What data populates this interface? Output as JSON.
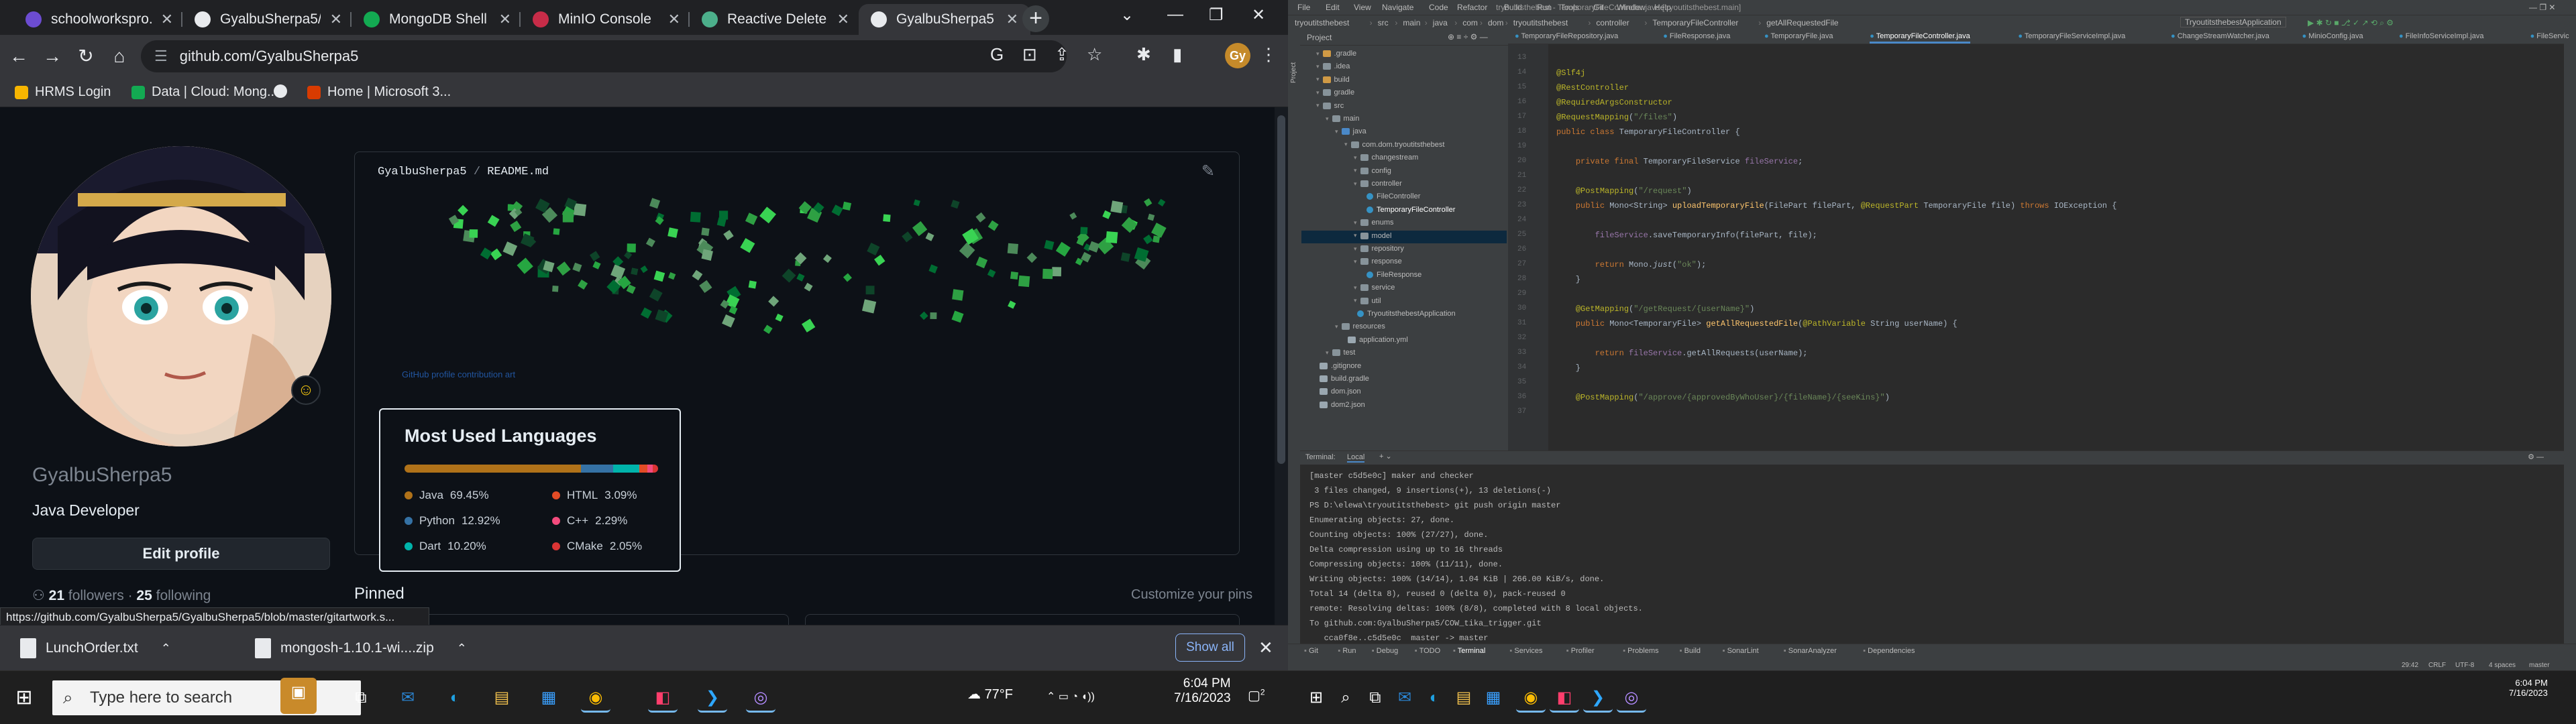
{
  "chrome": {
    "tabs": [
      {
        "title": "schoolworkspro.c",
        "color": "#6c4cd1"
      },
      {
        "title": "GyalbuSherpa5/C",
        "color": "#e8eaed"
      },
      {
        "title": "MongoDB Shell D",
        "color": "#13aa52"
      },
      {
        "title": "MinIO Console",
        "color": "#c72c48"
      },
      {
        "title": "Reactive Delete u",
        "color": "#4caf8b"
      },
      {
        "title": "GyalbuSherpa5",
        "color": "#e8eaed"
      }
    ],
    "url": "github.com/GyalbuSherpa5",
    "profile_initial": "Gy",
    "bookmarks": [
      "HRMS Login",
      "Data | Cloud: Mong...",
      "Home | Microsoft 3..."
    ],
    "status_url": "https://github.com/GyalbuSherpa5/GyalbuSherpa5/blob/master/gitartwork.s...",
    "downloads": [
      {
        "name": "LunchOrder.txt"
      },
      {
        "name": "mongosh-1.10.1-wi....zip"
      }
    ],
    "show_all": "Show all"
  },
  "github": {
    "username": "GyalbuSherpa5",
    "bio": "Java Developer",
    "edit_profile": "Edit profile",
    "followers_count": "21",
    "followers_label": "followers",
    "following_count": "25",
    "following_label": "following",
    "readme_owner": "GyalbuSherpa5",
    "readme_file": "README.md",
    "art_link": "GitHub profile contribution art",
    "pinned": "Pinned",
    "customize": "Customize your pins",
    "languages": {
      "title": "Most Used Languages",
      "items": [
        {
          "name": "Java",
          "pct": "69.45%",
          "value": 69.45,
          "color": "#b07219"
        },
        {
          "name": "Python",
          "pct": "12.92%",
          "value": 12.92,
          "color": "#3572a5"
        },
        {
          "name": "Dart",
          "pct": "10.20%",
          "value": 10.2,
          "color": "#00b4ab"
        },
        {
          "name": "HTML",
          "pct": "3.09%",
          "value": 3.09,
          "color": "#e34c26"
        },
        {
          "name": "C++",
          "pct": "2.29%",
          "value": 2.29,
          "color": "#f34b7d"
        },
        {
          "name": "CMake",
          "pct": "2.05%",
          "value": 2.05,
          "color": "#da3434"
        }
      ]
    }
  },
  "ide": {
    "menu": [
      "File",
      "Edit",
      "View",
      "Navigate",
      "Code",
      "Refactor",
      "Build",
      "Run",
      "Tools",
      "Git",
      "Window",
      "Help"
    ],
    "window_title": "tryoutitsthebest - TemporaryFileController.java [tryoutitsthebest.main]",
    "breadcrumbs": [
      "tryoutitsthebest",
      "src",
      "main",
      "java",
      "com",
      "dom",
      "tryoutitsthebest",
      "controller",
      "TemporaryFileController",
      "getAllRequestedFile"
    ],
    "run_config": "TryoutitsthebestApplication",
    "project_label": "Project",
    "tree": [
      {
        "label": ".gradle",
        "depth": 1,
        "kind": "folder-orange"
      },
      {
        "label": ".idea",
        "depth": 1,
        "kind": "folder"
      },
      {
        "label": "build",
        "depth": 1,
        "kind": "folder-orange"
      },
      {
        "label": "gradle",
        "depth": 1,
        "kind": "folder"
      },
      {
        "label": "src",
        "depth": 1,
        "kind": "folder"
      },
      {
        "label": "main",
        "depth": 2,
        "kind": "folder"
      },
      {
        "label": "java",
        "depth": 3,
        "kind": "folder-blue"
      },
      {
        "label": "com.dom.tryoutitsthebest",
        "depth": 4,
        "kind": "package"
      },
      {
        "label": "changestream",
        "depth": 5,
        "kind": "package"
      },
      {
        "label": "config",
        "depth": 5,
        "kind": "package"
      },
      {
        "label": "controller",
        "depth": 5,
        "kind": "package"
      },
      {
        "label": "FileController",
        "depth": 6,
        "kind": "class"
      },
      {
        "label": "TemporaryFileController",
        "depth": 6,
        "kind": "class"
      },
      {
        "label": "enums",
        "depth": 5,
        "kind": "package"
      },
      {
        "label": "model",
        "depth": 5,
        "kind": "package"
      },
      {
        "label": "repository",
        "depth": 5,
        "kind": "package"
      },
      {
        "label": "response",
        "depth": 5,
        "kind": "package"
      },
      {
        "label": "FileResponse",
        "depth": 6,
        "kind": "class"
      },
      {
        "label": "service",
        "depth": 5,
        "kind": "package"
      },
      {
        "label": "util",
        "depth": 5,
        "kind": "package"
      },
      {
        "label": "TryoutitsthebestApplication",
        "depth": 5,
        "kind": "class"
      },
      {
        "label": "resources",
        "depth": 3,
        "kind": "folder"
      },
      {
        "label": "application.yml",
        "depth": 4,
        "kind": "file"
      },
      {
        "label": "test",
        "depth": 2,
        "kind": "folder"
      },
      {
        "label": ".gitignore",
        "depth": 1,
        "kind": "file"
      },
      {
        "label": "build.gradle",
        "depth": 1,
        "kind": "file"
      },
      {
        "label": "dom.json",
        "depth": 1,
        "kind": "file"
      },
      {
        "label": "dom2.json",
        "depth": 1,
        "kind": "file"
      }
    ],
    "editor_tabs": [
      "TemporaryFileRepository.java",
      "FileResponse.java",
      "TemporaryFile.java",
      "TemporaryFileController.java",
      "TemporaryFileServiceImpl.java",
      "ChangeStreamWatcher.java",
      "MinioConfig.java",
      "FileInfoServiceImpl.java",
      "FileServic"
    ],
    "terminal": {
      "title": "Terminal:",
      "tab": "Local",
      "lines": [
        "[master c5d5e0c] maker and checker",
        " 3 files changed, 9 insertions(+), 13 deletions(-)",
        "PS D:\\elewa\\tryoutitsthebest> git push origin master",
        "Enumerating objects: 27, done.",
        "Counting objects: 100% (27/27), done.",
        "Delta compression using up to 16 threads",
        "Compressing objects: 100% (11/11), done.",
        "Writing objects: 100% (14/14), 1.04 KiB | 266.00 KiB/s, done.",
        "Total 14 (delta 8), reused 0 (delta 0), pack-reused 0",
        "remote: Resolving deltas: 100% (8/8), completed with 8 local objects.",
        "To github.com:GyalbuSherpa5/COW_tika_trigger.git",
        "   cca0f8e..c5d5e0c  master -> master",
        "PS D:\\elewa\\tryoutitsthebest> "
      ]
    },
    "bottom_tools": [
      "Git",
      "Run",
      "Debug",
      "TODO",
      "Terminal",
      "Services",
      "Profiler",
      "Problems",
      "Build",
      "SonarLint",
      "SonarAnalyzer",
      "Dependencies"
    ],
    "status": {
      "pos": "29:42",
      "eol": "CRLF",
      "enc": "UTF-8",
      "indent": "4 spaces",
      "branch": "master"
    }
  },
  "taskbar": {
    "search_placeholder": "Type here to search",
    "weather": "77°F",
    "time": "6:04 PM",
    "date": "7/16/2023",
    "notif_count": "2",
    "time2": "6:04 PM",
    "date2": "7/16/2023"
  }
}
